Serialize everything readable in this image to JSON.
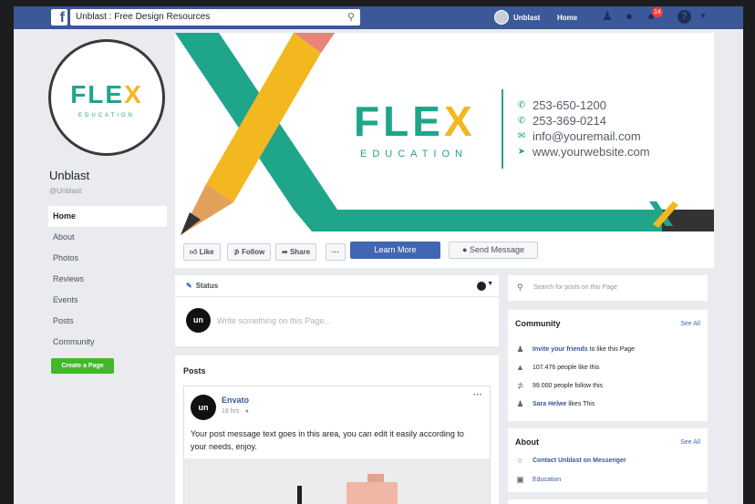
{
  "topbar": {
    "logo": "f",
    "search_value": "Unblast : Free Design Resources",
    "user_name": "Unblast",
    "home_label": "Home",
    "notification_count": "14"
  },
  "profile": {
    "logo_word_start": "FLE",
    "logo_word_x": "X",
    "logo_sub": "EDUCATION",
    "page_name": "Unblast",
    "handle": "@Unblast"
  },
  "left_nav": {
    "items": [
      "Home",
      "About",
      "Photos",
      "Reviews",
      "Events",
      "Posts",
      "Community"
    ],
    "create_label": "Create a Page"
  },
  "cover": {
    "brand_start": "FLE",
    "brand_x": "X",
    "brand_sub": "EDUCATION",
    "contacts": [
      {
        "icon": "phone-icon",
        "text": "253-650-1200"
      },
      {
        "icon": "phone-icon",
        "text": "253-369-0214"
      },
      {
        "icon": "mail-icon",
        "text": "info@youremail.com"
      },
      {
        "icon": "web-icon",
        "text": "www.yourwebsite.com"
      }
    ],
    "colors": {
      "teal": "#1fa58a",
      "yellow": "#f3b81f",
      "pink": "#e8847a",
      "wood": "#e2a05a",
      "dark": "#333333"
    }
  },
  "actions": {
    "like": "Like",
    "follow": "Follow",
    "share": "Share",
    "more": "···",
    "learn_more": "Learn More",
    "send_message": "Send Message"
  },
  "composer": {
    "status_label": "Status",
    "avatar_text": "un",
    "placeholder": "Write something on this Page..."
  },
  "posts": {
    "title": "Posts",
    "post": {
      "avatar_text": "un",
      "author": "Envato",
      "meta": "18 hrs ·",
      "more": "···",
      "text": "Your post message text goes in this area, you can edit it easily according to your needs, enjoy."
    }
  },
  "right": {
    "search_placeholder": "Search for posts on this Page",
    "community": {
      "title": "Community",
      "see_all": "See All",
      "invite_link": "Invite your friends",
      "invite_rest": "to like this Page",
      "likes": "107.476 people like this",
      "follows": "99.000 people follow this",
      "friend_name": "Sara Helwe",
      "friend_rest": "likes This"
    },
    "about": {
      "title": "About",
      "see_all": "See All",
      "messenger": "Contact Unblast on Messenger",
      "category": "Education"
    }
  }
}
